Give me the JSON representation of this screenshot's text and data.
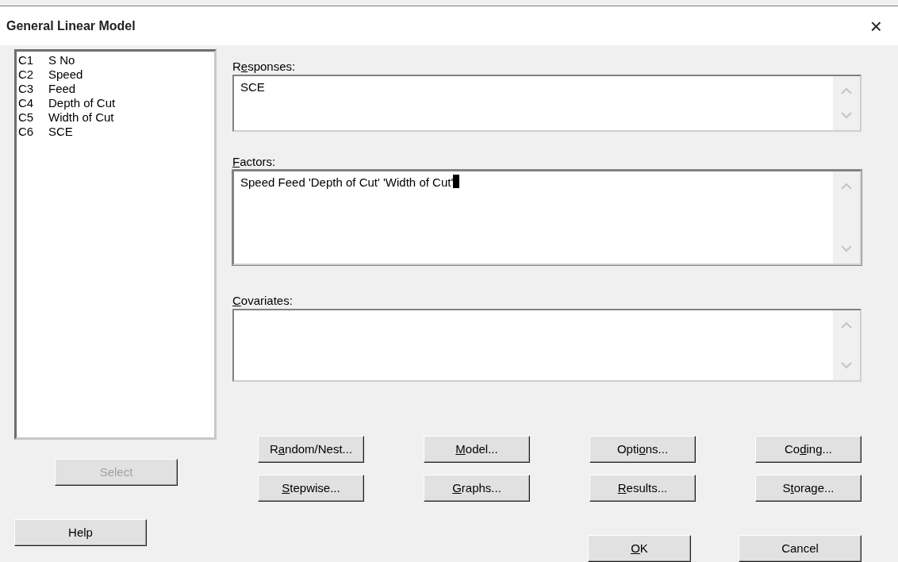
{
  "window": {
    "title": "General Linear Model",
    "close": "×"
  },
  "columns": [
    {
      "id": "C1",
      "name": "S No",
      "selected": false
    },
    {
      "id": "C2",
      "name": "Speed",
      "selected": false
    },
    {
      "id": "C3",
      "name": "Feed",
      "selected": false
    },
    {
      "id": "C4",
      "name": "Depth of Cut",
      "selected": false
    },
    {
      "id": "C5",
      "name": "Width of Cut",
      "selected": false
    },
    {
      "id": "C6",
      "name": "SCE",
      "selected": false
    }
  ],
  "fields": [
    {
      "label": {
        "pre": "R",
        "key": "e",
        "post": "sponses:"
      },
      "value": "SCE",
      "focused": false
    },
    {
      "label": {
        "key": "F",
        "post": "actors:"
      },
      "value": "Speed Feed 'Depth of Cut' 'Width of Cut'",
      "focused": true
    },
    {
      "label": {
        "key": "C",
        "post": "ovariates:"
      },
      "focused": false
    }
  ],
  "option_buttons": [
    {
      "pre": "R",
      "key": "a",
      "post": "ndom/Nest..."
    },
    {
      "key": "M",
      "post": "odel..."
    },
    {
      "pre": "Opti",
      "key": "o",
      "post": "ns..."
    },
    {
      "pre": "Co",
      "key": "d",
      "post": "ing..."
    },
    {
      "key": "S",
      "post": "tepwise..."
    },
    {
      "key": "G",
      "post": "raphs..."
    },
    {
      "key": "R",
      "post": "esults..."
    },
    {
      "pre": "S",
      "key": "t",
      "post": "orage..."
    }
  ],
  "select_button": {
    "label": "Select",
    "disabled": true
  },
  "help_button": {
    "label": "Help"
  },
  "ok_button": {
    "key": "O",
    "post": "K"
  },
  "cancel_button": {
    "label": "Cancel"
  }
}
